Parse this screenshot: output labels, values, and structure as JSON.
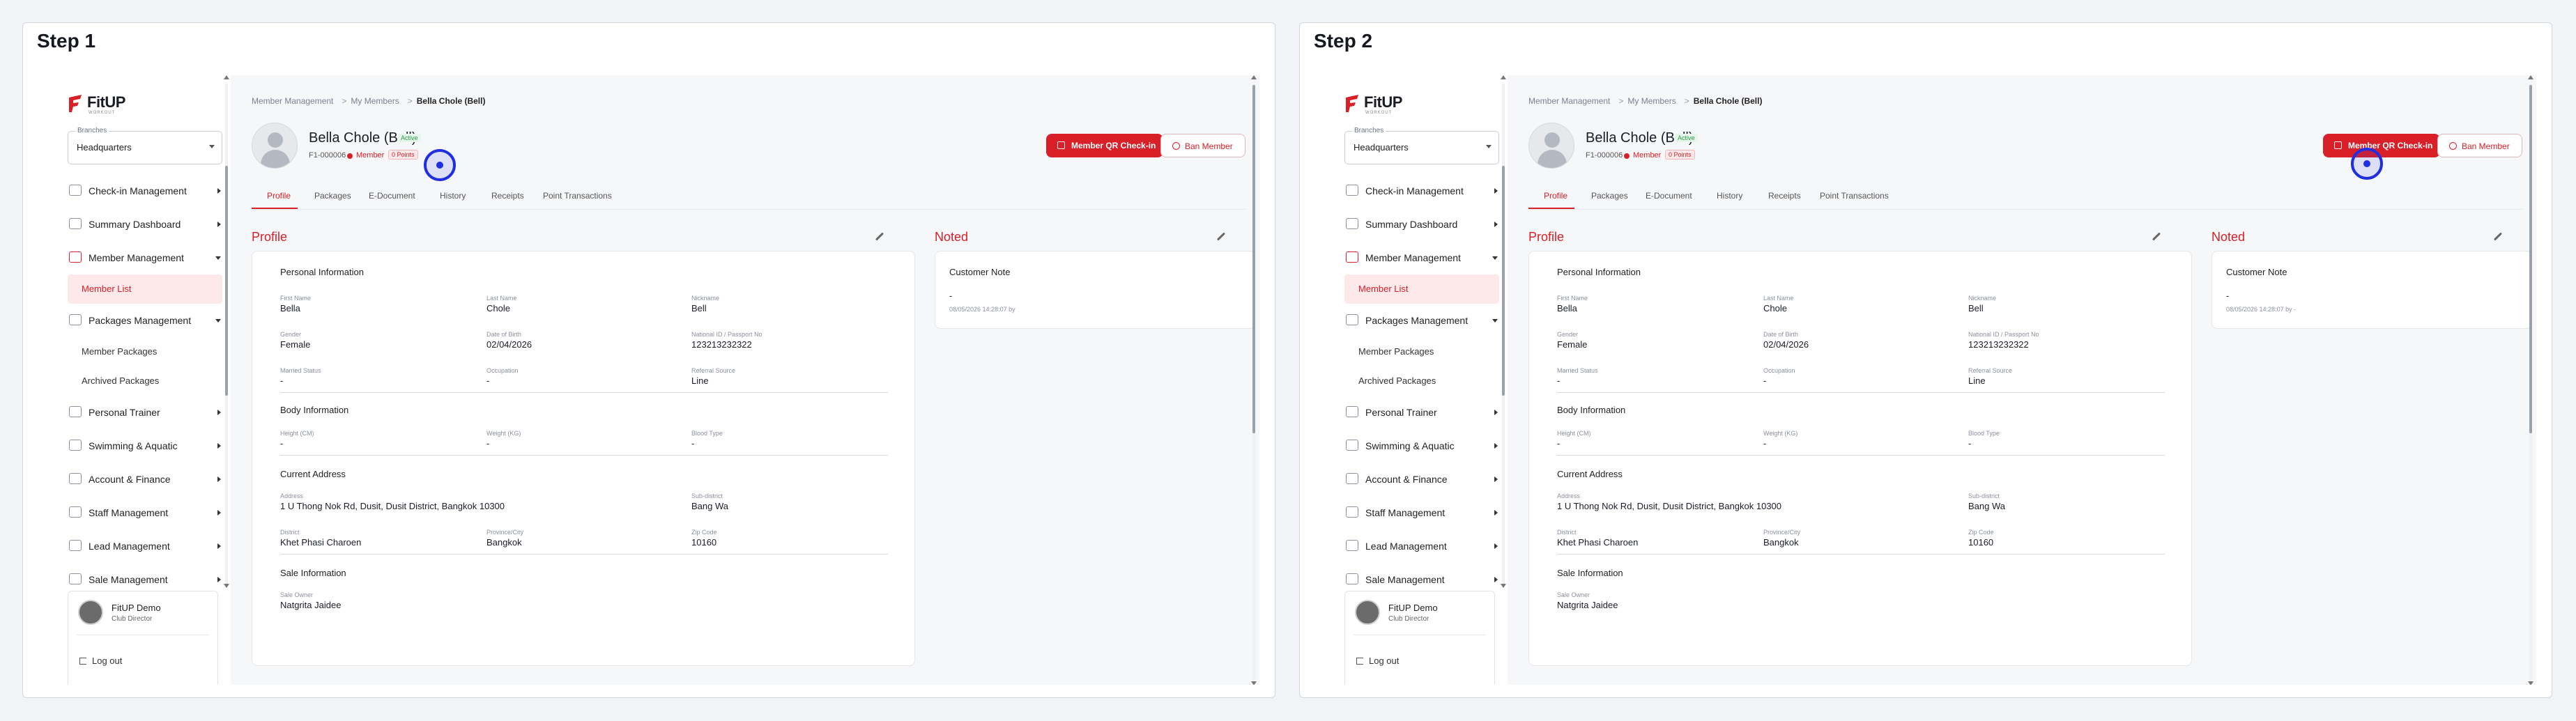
{
  "steps": [
    {
      "title": "Step 1"
    },
    {
      "title": "Step 2"
    }
  ],
  "sidebar": {
    "logo": "FitUP",
    "logo_sub": "WORKOUT",
    "branch_label": "Branches",
    "branch_value": "Headquarters",
    "items": {
      "checkin": "Check-in Management",
      "summary": "Summary Dashboard",
      "member": "Member Management",
      "member_list": "Member List",
      "packages": "Packages Management",
      "member_packages": "Member Packages",
      "archived_packages": "Archived Packages",
      "trainer": "Personal Trainer",
      "swimming": "Swimming & Aquatic",
      "finance": "Account & Finance",
      "staff": "Staff Management",
      "lead": "Lead Management",
      "sale": "Sale Management"
    },
    "user": {
      "name": "FitUP Demo",
      "role": "Club Director",
      "logout": "Log out"
    }
  },
  "breadcrumb": {
    "a": "Member Management",
    "b": "My Members",
    "c": "Bella Chole (Bell)"
  },
  "profile_header": {
    "name": "Bella Chole (Bell)",
    "status": "Active",
    "id": "F1-000006",
    "member": "Member",
    "points": "0 Points",
    "qr_button": "Member QR Check-in",
    "ban_button": "Ban Member"
  },
  "tabs": {
    "profile": "Profile",
    "packages": "Packages",
    "edoc": "E-Document",
    "history": "History",
    "receipts": "Receipts",
    "points": "Point Transactions"
  },
  "profile": {
    "title": "Profile",
    "personal_title": "Personal Information",
    "first_name_l": "First Name",
    "first_name": "Bella",
    "last_name_l": "Last Name",
    "last_name": "Chole",
    "nickname_l": "Nickname",
    "nickname": "Bell",
    "gender_l": "Gender",
    "gender": "Female",
    "dob_l": "Date of Birth",
    "dob": "02/04/2026",
    "national_l": "National ID / Passport No",
    "national": "123213232322",
    "marital_l": "Married Status",
    "marital": "-",
    "occupation_l": "Occupation",
    "occupation": "-",
    "referral_l": "Referral Source",
    "referral": "Line",
    "body_title": "Body Information",
    "height_l": "Height (CM)",
    "height": "-",
    "weight_l": "Weight (KG)",
    "weight": "-",
    "blood_l": "Blood Type",
    "blood": "-",
    "address_title": "Current Address",
    "address_l": "Address",
    "address": "1 U Thong Nok Rd, Dusit, Dusit District, Bangkok 10300",
    "subdistrict_l": "Sub-district",
    "subdistrict": "Bang Wa",
    "district_l": "District",
    "district": "Khet Phasi Charoen",
    "province_l": "Province/City",
    "province": "Bangkok",
    "zip_l": "Zip Code",
    "zip": "10160",
    "sale_title": "Sale Information",
    "sale_owner_l": "Sale Owner",
    "sale_owner": "Natgrita Jaidee"
  },
  "noted": {
    "title": "Noted",
    "customer_note_title": "Customer Note",
    "note_value": "-",
    "note_meta_1": "08/05/2026 14:28:07 by",
    "note_meta_2": "08/05/2026 14:28:07 by -"
  },
  "colors": {
    "accent": "#d92028",
    "click_marker": "#1e2ee0"
  }
}
